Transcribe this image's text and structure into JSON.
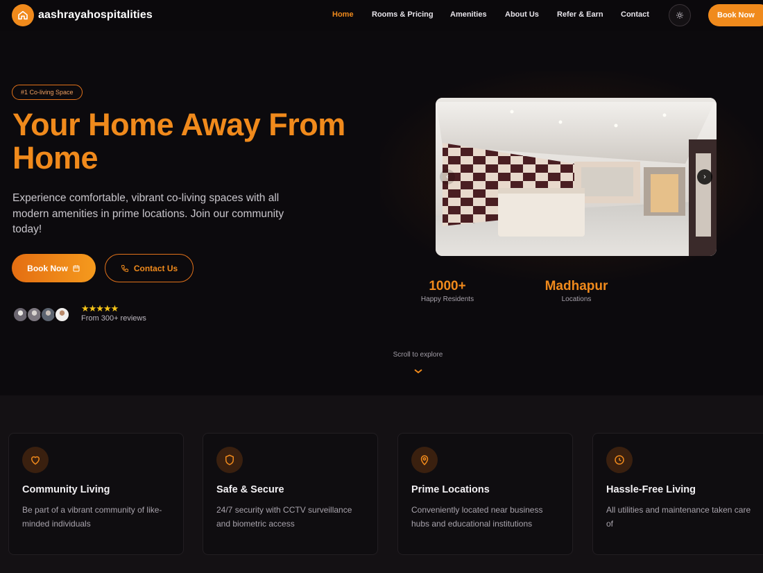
{
  "brand": {
    "name": "aashrayahospitalities",
    "logo_icon": "home-icon"
  },
  "nav": {
    "links": [
      {
        "label": "Home",
        "active": true
      },
      {
        "label": "Rooms & Pricing",
        "active": false
      },
      {
        "label": "Amenities",
        "active": false
      },
      {
        "label": "About Us",
        "active": false
      },
      {
        "label": "Refer & Earn",
        "active": false
      },
      {
        "label": "Contact",
        "active": false
      }
    ],
    "theme_icon": "sun-icon",
    "cta_label": "Book Now"
  },
  "hero": {
    "badge": "#1 Co-living Space",
    "title": "Your Home Away From Home",
    "description": "Experience comfortable, vibrant co-living spaces with all modern amenities in prime locations. Join our community today!",
    "primary_button": "Book Now",
    "secondary_button": "Contact Us",
    "rating": {
      "stars": "★★★★★",
      "stars_count": 5,
      "reviews_text": "From 300+ reviews"
    },
    "stats": [
      {
        "value": "1000+",
        "label": "Happy Residents"
      },
      {
        "value": "Madhapur",
        "label": "Locations"
      }
    ],
    "scroll_hint": "Scroll to explore"
  },
  "features": [
    {
      "icon": "heart-icon",
      "title": "Community Living",
      "description": "Be part of a vibrant community of like-minded individuals"
    },
    {
      "icon": "shield-icon",
      "title": "Safe & Secure",
      "description": "24/7 security with CCTV surveillance and biometric access"
    },
    {
      "icon": "map-pin-icon",
      "title": "Prime Locations",
      "description": "Conveniently located near business hubs and educational institutions"
    },
    {
      "icon": "clock-icon",
      "title": "Hassle-Free Living",
      "description": "All utilities and maintenance taken care of"
    }
  ],
  "colors": {
    "accent": "#f08a1c",
    "background": "#0b090c",
    "card": "#0f0d10"
  }
}
